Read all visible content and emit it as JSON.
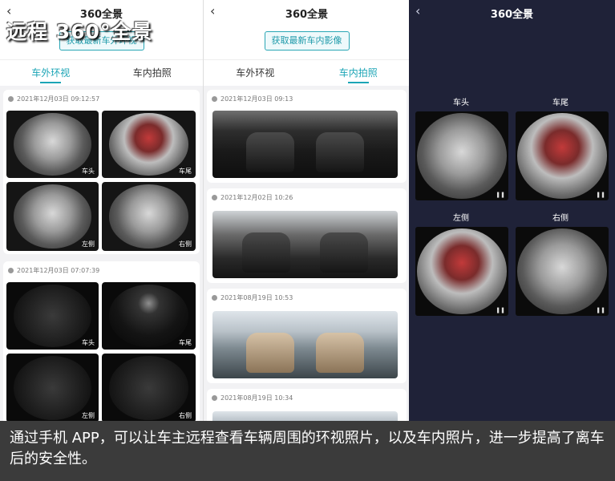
{
  "overlay_title": "远程 360°全景",
  "panel1": {
    "title": "360全景",
    "fetch_button": "获取最新车外环视",
    "tabs": [
      "车外环视",
      "车内拍照"
    ],
    "active_tab": 0,
    "cards": [
      {
        "timestamp": "2021年12月03日 09:12:57",
        "thumbs": [
          {
            "label": "车头",
            "style": "light"
          },
          {
            "label": "车尾",
            "style": "red"
          },
          {
            "label": "左侧",
            "style": "light"
          },
          {
            "label": "右侧",
            "style": "light"
          }
        ]
      },
      {
        "timestamp": "2021年12月03日 07:07:39",
        "thumbs": [
          {
            "label": "车头",
            "style": "dark"
          },
          {
            "label": "车尾",
            "style": "moon"
          },
          {
            "label": "左侧",
            "style": "dark"
          },
          {
            "label": "右侧",
            "style": "dark"
          }
        ]
      }
    ]
  },
  "panel2": {
    "title": "360全景",
    "fetch_button": "获取最新车内影像",
    "tabs": [
      "车外环视",
      "车内拍照"
    ],
    "active_tab": 1,
    "cards": [
      {
        "timestamp": "2021年12月03日 09:13",
        "style": "dark"
      },
      {
        "timestamp": "2021年12月02日 10:26",
        "style": "dark"
      },
      {
        "timestamp": "2021年08月19日 10:53",
        "style": "light"
      },
      {
        "timestamp": "2021年08月19日 10:34",
        "style": "light"
      }
    ]
  },
  "panel3": {
    "title": "360全景",
    "views": [
      {
        "label": "车头",
        "style": "light"
      },
      {
        "label": "车尾",
        "style": "red"
      },
      {
        "label": "左侧",
        "style": "red"
      },
      {
        "label": "右侧",
        "style": "light"
      }
    ]
  },
  "caption": "通过手机 APP，可以让车主远程查看车辆周围的环视照片，以及车内照片，进一步提高了离车后的安全性。"
}
